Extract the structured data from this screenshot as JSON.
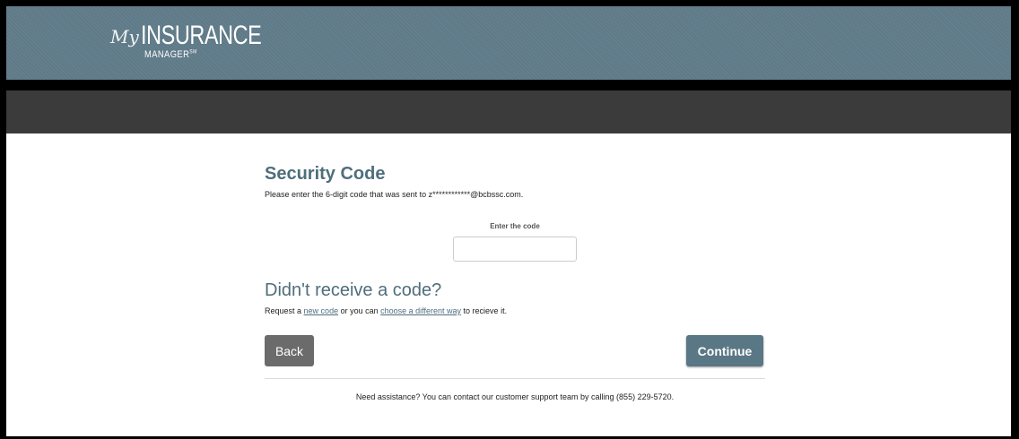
{
  "header": {
    "logo_my": "My",
    "logo_insurance": "INSURANCE",
    "logo_manager": "MANAGER",
    "logo_sm": "SM"
  },
  "security": {
    "title": "Security Code",
    "description": "Please enter the 6-digit code that was sent to z************@bcbssc.com.",
    "field_label": "Enter the code",
    "field_value": ""
  },
  "resend": {
    "title": "Didn't receive a code?",
    "prefix": "Request a",
    "new_code_link": "new code",
    "middle": "or you can",
    "different_way_link": "choose a different way",
    "suffix": "to recieve it."
  },
  "buttons": {
    "back": "Back",
    "continue": "Continue"
  },
  "footer": {
    "assistance": "Need assistance? You can contact our customer support team by calling (855) 229-5720."
  },
  "colors": {
    "header_bg": "#5f7a88",
    "navbar_bg": "#3b3b3b",
    "heading": "#4f6e7c",
    "back_button": "#6b6b6b",
    "continue_button": "#5a7785"
  }
}
